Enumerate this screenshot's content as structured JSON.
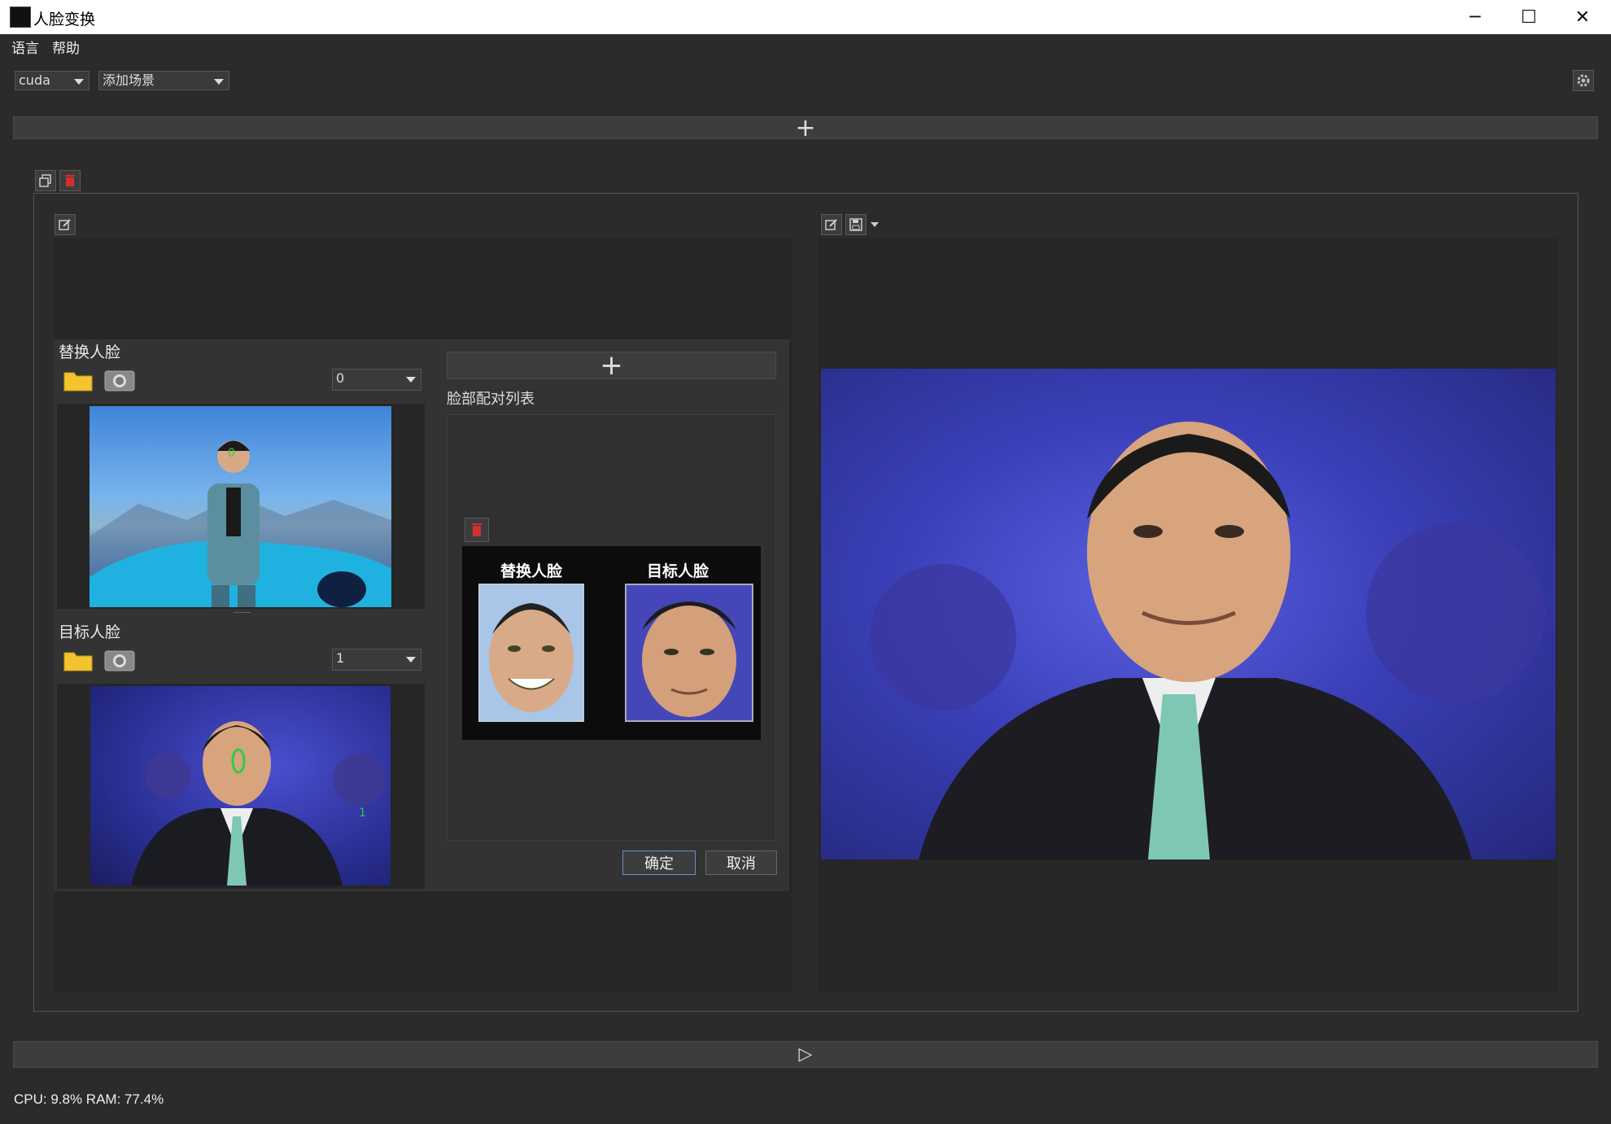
{
  "window": {
    "title": "人脸变换",
    "controls": {
      "minimize": "─",
      "maximize": "☐",
      "close": "✕"
    }
  },
  "menu": {
    "items": [
      "语言",
      "帮助"
    ]
  },
  "toolbar": {
    "device_select": "cuda",
    "scene_select": "添加场景",
    "add_symbol": "+",
    "run_symbol": "▷"
  },
  "source": {
    "replace_face_label": "替换人脸",
    "replace_face_index": "0",
    "target_face_label": "目标人脸",
    "target_face_index": "1",
    "source_face_marker": "0",
    "target_face_marker": "0",
    "secondary_marker": "1"
  },
  "pairing": {
    "add_symbol": "+",
    "list_label": "脸部配对列表",
    "pair_card": {
      "replace_label": "替换人脸",
      "target_label": "目标人脸"
    },
    "confirm_label": "确定",
    "cancel_label": "取消"
  },
  "status": {
    "text": "CPU: 9.8%  RAM: 77.4%"
  },
  "colors": {
    "background": "#2b2b2b",
    "panel_dark": "#262626",
    "panel_mid": "#333333",
    "delete_red": "#d32f2f",
    "folder_yellow": "#f4c430",
    "face_marker_green": "#2ecc40"
  },
  "icons": {
    "folder": "folder-icon",
    "camera": "camera-icon",
    "edit": "edit-icon",
    "save": "save-icon",
    "copy": "copy-icon",
    "trash": "trash-icon",
    "settings": "gear-icon"
  }
}
